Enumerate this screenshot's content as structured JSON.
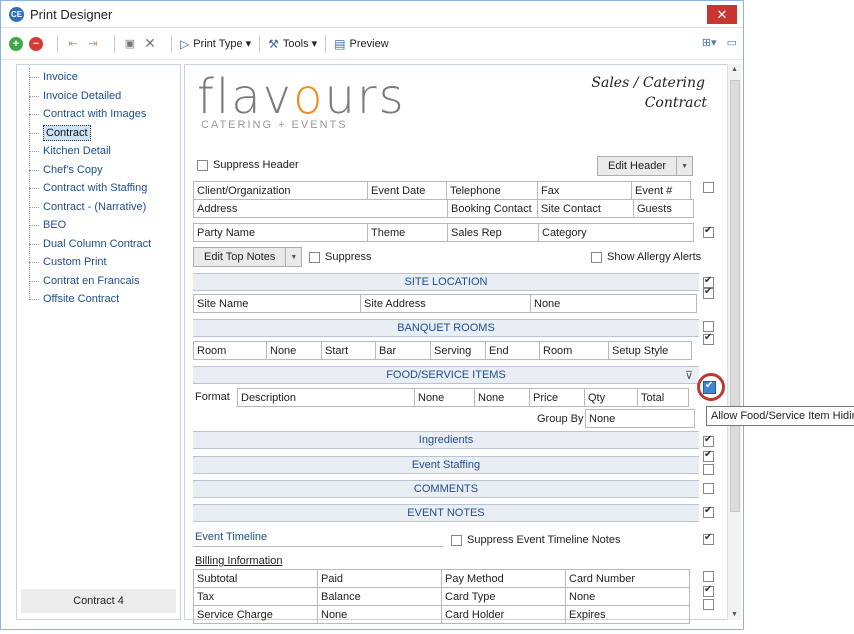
{
  "window": {
    "title": "Print Designer"
  },
  "toolbar": {
    "print_type": "Print Type",
    "tools": "Tools",
    "preview": "Preview"
  },
  "tree": {
    "items": [
      "Invoice",
      "Invoice Detailed",
      "Contract with Images",
      "Contract",
      "Kitchen Detail",
      "Chef's Copy",
      "Contract with Staffing",
      "Contract - (Narrative)",
      "BEO",
      "Dual Column Contract",
      "Custom Print",
      "Contrat en Francais",
      "Offsite Contract"
    ],
    "selected": "Contract",
    "footer": "Contract 4"
  },
  "doc": {
    "logo": {
      "main_before": "flav",
      "main_o": "o",
      "main_after": "urs",
      "sub": "CATERING + EVENTS"
    },
    "contract_title_1": "Sales / Catering",
    "contract_title_2": "Contract",
    "suppress_header": "Suppress Header",
    "edit_header": "Edit Header",
    "row1": [
      "Client/Organization",
      "Event Date",
      "Telephone",
      "Fax",
      "Event #"
    ],
    "row2": [
      "Address",
      "Booking Contact",
      "Site Contact",
      "Guests"
    ],
    "row3": [
      "Party Name",
      "Theme",
      "Sales Rep",
      "Category"
    ],
    "edit_top_notes": "Edit Top Notes",
    "suppress": "Suppress",
    "show_allergy": "Show Allergy Alerts",
    "site_location": "SITE LOCATION",
    "site_row": [
      "Site Name",
      "Site Address",
      "None"
    ],
    "banquet_rooms": "BANQUET ROOMS",
    "banquet_row": [
      "Room",
      "None",
      "Start",
      "Bar",
      "Serving",
      "End",
      "Room",
      "Setup Style"
    ],
    "food_service": "FOOD/SERVICE ITEMS",
    "format_label": "Format",
    "food_row": [
      "Description",
      "None",
      "None",
      "Price",
      "Qty",
      "Total"
    ],
    "group_by_label": "Group By",
    "group_by_value": "None",
    "ingredients": "Ingredients",
    "event_staffing": "Event Staffing",
    "comments": "COMMENTS",
    "event_notes": "EVENT NOTES",
    "event_timeline": "Event Timeline",
    "suppress_timeline": "Suppress Event Timeline Notes",
    "billing_info": "Billing Information",
    "billing_rows": [
      [
        "Subtotal",
        "Paid",
        "Pay Method",
        "Card Number"
      ],
      [
        "Tax",
        "Balance",
        "Card Type",
        "None"
      ],
      [
        "Service Charge",
        "None",
        "Card Holder",
        "Expires"
      ]
    ]
  },
  "tooltip": "Allow Food/Service Item Hidin"
}
